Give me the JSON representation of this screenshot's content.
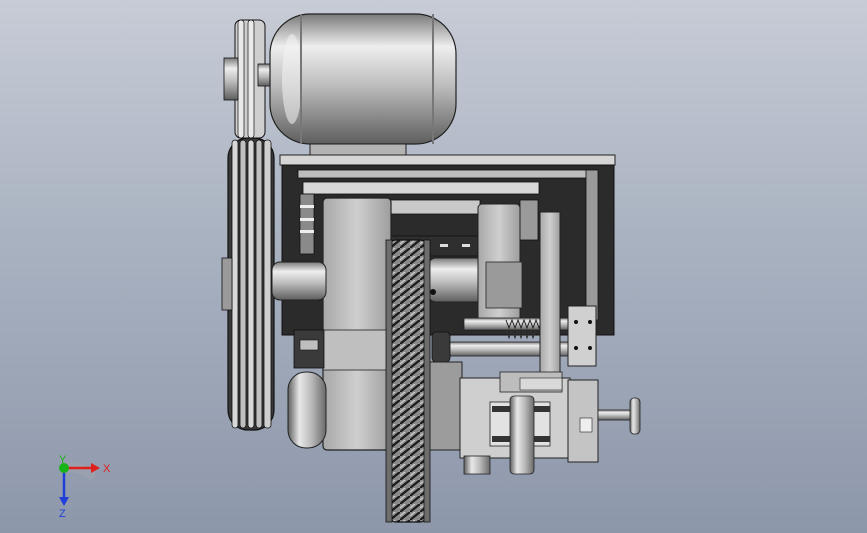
{
  "viewport": {
    "background_top": "#c7ccd6",
    "background_bottom": "#8d97aa"
  },
  "triad": {
    "x_label": "X",
    "y_label": "Y",
    "z_label": "Z",
    "x_color": "#e0201b",
    "y_color": "#19b419",
    "z_color": "#1f3fd8"
  },
  "model": {
    "metal_light": "#e6e6e6",
    "metal_mid": "#b9b9b9",
    "metal_dark": "#6f6f6f",
    "frame_dark": "#2b2b2b",
    "edge_color": "#1a1a1a"
  }
}
